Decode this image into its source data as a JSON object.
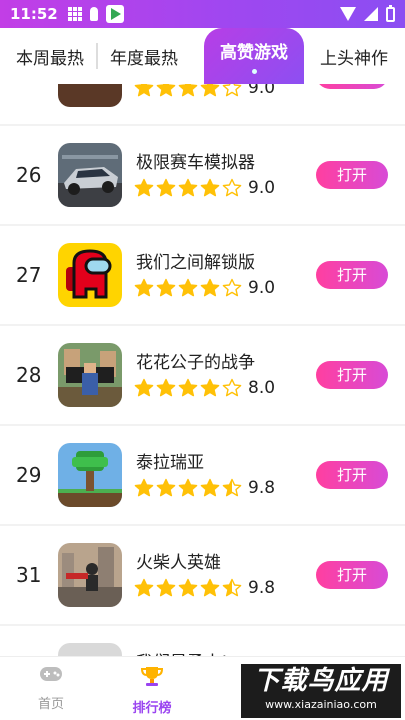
{
  "status_bar": {
    "time": "11:52"
  },
  "tabs": [
    {
      "label": "本周最热"
    },
    {
      "label": "年度最热"
    },
    {
      "label": "高赞游戏",
      "active": true
    },
    {
      "label": "上头神作"
    }
  ],
  "partial_top_row": {
    "score": "9.0",
    "rating": 4
  },
  "rows": [
    {
      "rank": "26",
      "name": "极限赛车模拟器",
      "score": "9.0",
      "rating": 4,
      "button": "打开",
      "icon": "racing-car-icon"
    },
    {
      "rank": "27",
      "name": "我们之间解锁版",
      "score": "9.0",
      "rating": 4,
      "button": "打开",
      "icon": "among-us-crewmate-icon"
    },
    {
      "rank": "28",
      "name": "花花公子的战争",
      "score": "8.0",
      "rating": 4,
      "button": "打开",
      "icon": "dude-theft-wars-icon"
    },
    {
      "rank": "29",
      "name": "泰拉瑞亚",
      "score": "9.8",
      "rating": 4.5,
      "button": "打开",
      "icon": "terraria-tree-icon"
    },
    {
      "rank": "31",
      "name": "火柴人英雄",
      "score": "9.8",
      "rating": 4.5,
      "button": "打开",
      "icon": "stickman-hero-icon"
    }
  ],
  "partial_bottom_row": {
    "name": "我们是勇士!"
  },
  "bottom_nav": [
    {
      "label": "首页",
      "icon": "gamepad-icon"
    },
    {
      "label": "排行榜",
      "icon": "trophy-icon",
      "active": true
    }
  ],
  "watermark": {
    "title": "下载鸟应用",
    "url": "www.xiazainiao.com"
  },
  "colors": {
    "accent": "#9a44f0",
    "button": "#e64bc0",
    "star": "#ffc107"
  }
}
